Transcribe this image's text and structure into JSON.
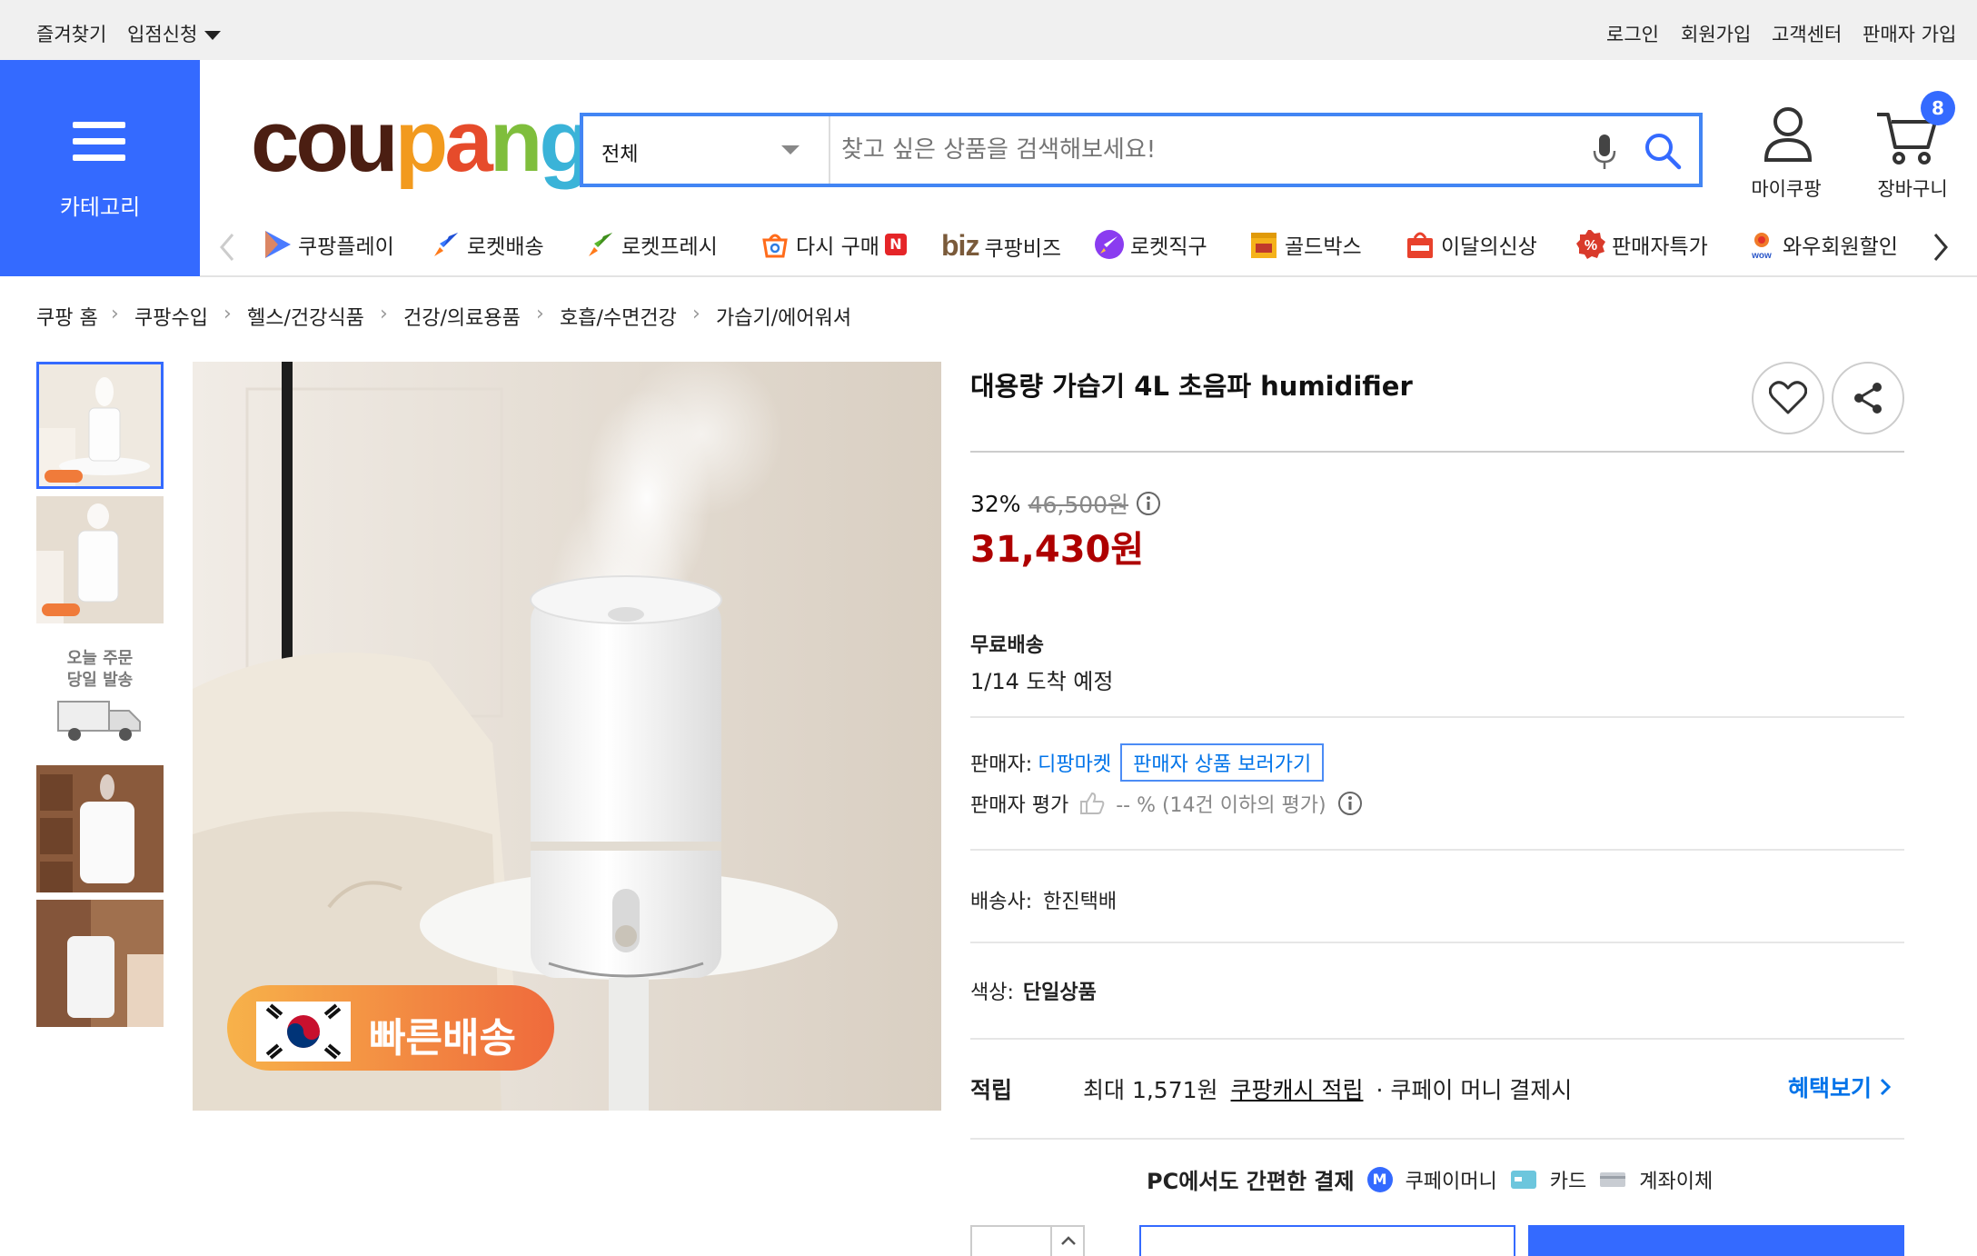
{
  "topbar": {
    "favorites": "즐겨찾기",
    "store_apply": "입점신청",
    "login": "로그인",
    "signup": "회원가입",
    "customer_center": "고객센터",
    "seller_signup": "판매자 가입"
  },
  "category_button": {
    "label": "카테고리"
  },
  "logo": {
    "text": "coupang"
  },
  "search": {
    "category": "전체",
    "placeholder": "찾고 싶은 상품을 검색해보세요!"
  },
  "header_icons": {
    "my_coupang": "마이쿠팡",
    "cart": "장바구니",
    "cart_count": "8"
  },
  "nav": {
    "items": [
      {
        "label": "쿠팡플레이",
        "icon": "play-icon"
      },
      {
        "label": "로켓배송",
        "icon": "rocket-icon"
      },
      {
        "label": "로켓프레시",
        "icon": "rocket-fresh-icon"
      },
      {
        "label": "다시 구매",
        "icon": "rebuy-icon",
        "badge": "N"
      },
      {
        "label": "쿠팡비즈",
        "prefix": "biz",
        "icon": "biz-icon"
      },
      {
        "label": "로켓직구",
        "icon": "rocket-global-icon"
      },
      {
        "label": "골드박스",
        "icon": "goldbox-icon"
      },
      {
        "label": "이달의신상",
        "icon": "new-bag-icon"
      },
      {
        "label": "판매자특가",
        "icon": "percent-icon"
      },
      {
        "label": "와우회원할인",
        "icon": "wow-icon"
      }
    ]
  },
  "breadcrumb": [
    "쿠팡 홈",
    "쿠팡수입",
    "헬스/건강식품",
    "건강/의료용품",
    "호흡/수면건강",
    "가습기/에어워셔"
  ],
  "gallery": {
    "thumb3_text_line1": "오늘 주문",
    "thumb3_text_line2": "당일 발송",
    "badge_text": "빠른배송"
  },
  "product": {
    "title": "대용량 가습기 4L 초음파 humidifier",
    "discount_rate": "32%",
    "original_price": "46,500원",
    "price": "31,430원",
    "shipping_label": "무료배송",
    "arrival": "1/14 도착 예정",
    "seller_label": "판매자:",
    "seller_name": "디팡마켓",
    "seller_products_button": "판매자 상품 보러가기",
    "seller_rating_label": "판매자 평가",
    "seller_rating_value": "-- % (14건 이하의 평가)",
    "courier_label": "배송사:",
    "courier_name": "한진택배",
    "color_label": "색상:",
    "color_value": "단일상품",
    "reward_label": "적립",
    "reward_text_1": "최대 1,571원",
    "reward_link": "쿠팡캐시 적립",
    "reward_text_2": "· 쿠페이 머니 결제시",
    "benefit_link": "혜택보기",
    "pay_title": "PC에서도 간편한 결제",
    "pay_coupay": "쿠페이머니",
    "pay_card": "카드",
    "pay_transfer": "계좌이체"
  },
  "colors": {
    "brand_blue": "#346aff",
    "search_border": "#4285f4",
    "price_red": "#ae0000",
    "link_blue": "#0073e9"
  }
}
